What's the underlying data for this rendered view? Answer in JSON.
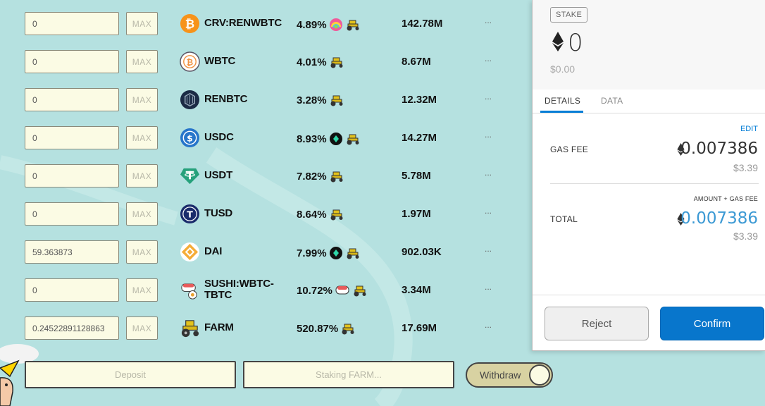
{
  "pools": [
    {
      "amount": "0",
      "max": "MAX",
      "name": "CRV:RENWBTC",
      "apy": "4.89%",
      "tvl": "142.78M",
      "more": "...",
      "icon": "bitcoin-icon",
      "rewards": [
        "rainbow-icon",
        "tractor-icon"
      ]
    },
    {
      "amount": "0",
      "max": "MAX",
      "name": "WBTC",
      "apy": "4.01%",
      "tvl": "8.67M",
      "more": "...",
      "icon": "wbtc-icon",
      "rewards": [
        "tractor-icon"
      ]
    },
    {
      "amount": "0",
      "max": "MAX",
      "name": "RENBTC",
      "apy": "3.28%",
      "tvl": "12.32M",
      "more": "...",
      "icon": "renbtc-icon",
      "rewards": [
        "tractor-icon"
      ]
    },
    {
      "amount": "0",
      "max": "MAX",
      "name": "USDC",
      "apy": "8.93%",
      "tvl": "14.27M",
      "more": "...",
      "icon": "usdc-icon",
      "rewards": [
        "curve-token-icon",
        "tractor-icon"
      ]
    },
    {
      "amount": "0",
      "max": "MAX",
      "name": "USDT",
      "apy": "7.82%",
      "tvl": "5.78M",
      "more": "...",
      "icon": "tether-icon",
      "rewards": [
        "tractor-icon"
      ]
    },
    {
      "amount": "0",
      "max": "MAX",
      "name": "TUSD",
      "apy": "8.64%",
      "tvl": "1.97M",
      "more": "...",
      "icon": "tusd-icon",
      "rewards": [
        "tractor-icon"
      ]
    },
    {
      "amount": "59.363873",
      "max": "MAX",
      "name": "DAI",
      "apy": "7.99%",
      "tvl": "902.03K",
      "more": "...",
      "icon": "dai-icon",
      "rewards": [
        "curve-token-icon",
        "tractor-icon"
      ]
    },
    {
      "amount": "0",
      "max": "MAX",
      "name": "SUSHI:WBTC-TBTC",
      "name_line1": "SUSHI:WBTC-",
      "name_line2": "TBTC",
      "apy": "10.72%",
      "tvl": "3.34M",
      "more": "...",
      "icon": "sushi-icon",
      "rewards": [
        "sushi-icon",
        "tractor-icon"
      ]
    },
    {
      "amount": "0.24522891128863",
      "max": "MAX",
      "name": "FARM",
      "apy": "520.87%",
      "tvl": "17.69M",
      "more": "...",
      "icon": "farm-tractor-icon",
      "rewards": [
        "tractor-icon"
      ]
    }
  ],
  "actions": {
    "deposit_label": "Deposit",
    "staking_label": "Staking FARM...",
    "withdraw_label": "Withdraw"
  },
  "wallet": {
    "tag": "STAKE",
    "stake_amount": "0",
    "stake_usd": "$0.00",
    "tabs": {
      "details": "DETAILS",
      "data": "DATA"
    },
    "edit_label": "EDIT",
    "gas_fee_label": "GAS FEE",
    "gas_fee_eth": "0.007386",
    "gas_fee_usd": "$3.39",
    "amount_gas_label": "AMOUNT + GAS FEE",
    "total_label": "TOTAL",
    "total_eth": "0.007386",
    "total_usd": "$3.39",
    "reject_label": "Reject",
    "confirm_label": "Confirm"
  },
  "colors": {
    "background": "#b5e1e0",
    "input_bg": "#fbfbe4",
    "confirm_blue": "#0876cc",
    "total_blue": "#3b99d4",
    "tab_underline": "#037dd6"
  }
}
